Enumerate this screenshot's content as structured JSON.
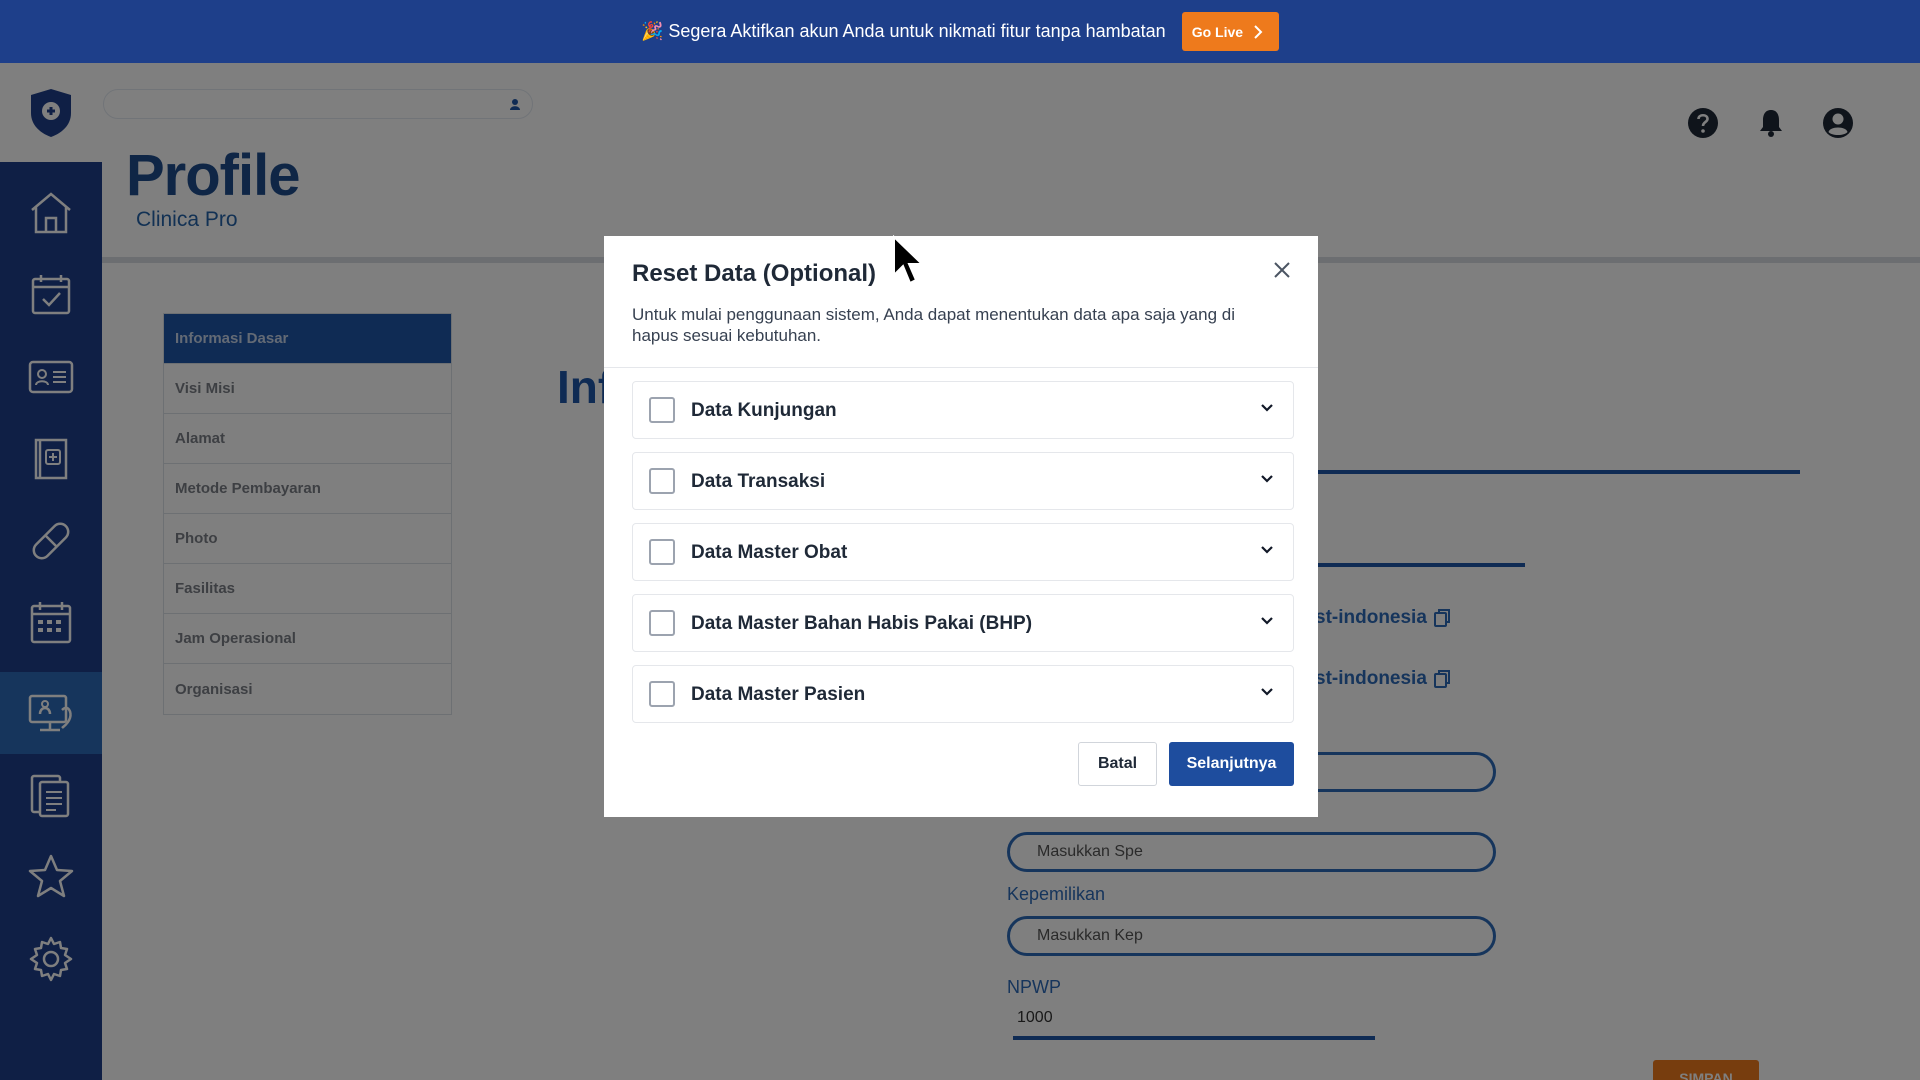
{
  "banner": {
    "emoji": "🎉",
    "text": "Segera Aktifkan akun Anda untuk nikmati fitur tanpa hambatan",
    "button_label": "Go Live"
  },
  "header": {
    "title": "Profile",
    "subtitle": "Clinica Pro"
  },
  "sidebar": {
    "items": [
      {
        "icon": "home-icon"
      },
      {
        "icon": "calendar-check-icon"
      },
      {
        "icon": "id-card-icon"
      },
      {
        "icon": "medical-book-icon"
      },
      {
        "icon": "pill-icon"
      },
      {
        "icon": "schedule-grid-icon"
      },
      {
        "icon": "monitor-clinic-icon",
        "active": true
      },
      {
        "icon": "clipboard-list-icon"
      },
      {
        "icon": "star-icon"
      },
      {
        "icon": "settings-icon"
      }
    ]
  },
  "profile_menu": {
    "items": [
      "Informasi Dasar",
      "Visi Misi",
      "Alamat",
      "Metode Pembayaran",
      "Photo",
      "Fasilitas",
      "Jam Operasional",
      "Organisasi"
    ]
  },
  "form": {
    "heading": "Inf",
    "link1": "st-indonesia",
    "link2": "st-indonesia",
    "spesialisasi_placeholder": "Masukkan Spe",
    "kepemilikan_label": "Kepemilikan",
    "kepemilikan_placeholder": "Masukkan Kep",
    "npwp_label": "NPWP",
    "npwp_value": "1000",
    "save_label": "SIMPAN"
  },
  "modal": {
    "title": "Reset Data (Optional)",
    "description": "Untuk mulai penggunaan sistem, Anda dapat menentukan data apa saja yang di hapus sesuai kebutuhan.",
    "options": [
      "Data Kunjungan",
      "Data Transaksi",
      "Data Master Obat",
      "Data Master Bahan Habis Pakai (BHP)",
      "Data Master Pasien"
    ],
    "cancel_label": "Batal",
    "next_label": "Selanjutnya"
  },
  "colors": {
    "brand_navy": "#1e3f8a",
    "brand_blue": "#1e57a8",
    "accent_orange": "#ee7a1c"
  }
}
